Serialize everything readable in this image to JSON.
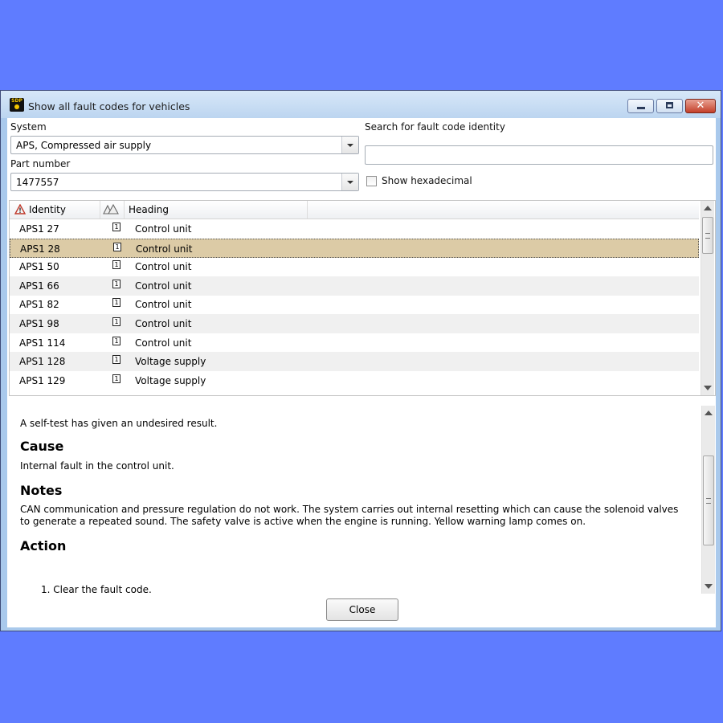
{
  "window": {
    "title": "Show all fault codes for vehicles",
    "app_icon_text": "SDP",
    "close_glyph": "✕"
  },
  "filters": {
    "system_label": "System",
    "system_value": "APS, Compressed air supply",
    "search_label": "Search for fault code identity",
    "search_value": "",
    "part_label": "Part number",
    "part_value": "1477557",
    "hex_label": "Show hexadecimal",
    "hex_checked": false
  },
  "list": {
    "columns": [
      "Identity",
      "Heading"
    ],
    "rows": [
      {
        "identity": "APS1 27",
        "icon": "1",
        "heading": "Control unit"
      },
      {
        "identity": "APS1 28",
        "icon": "1",
        "heading": "Control unit"
      },
      {
        "identity": "APS1 50",
        "icon": "1",
        "heading": "Control unit"
      },
      {
        "identity": "APS1 66",
        "icon": "1",
        "heading": "Control unit"
      },
      {
        "identity": "APS1 82",
        "icon": "1",
        "heading": "Control unit"
      },
      {
        "identity": "APS1 98",
        "icon": "1",
        "heading": "Control unit"
      },
      {
        "identity": "APS1 114",
        "icon": "1",
        "heading": "Control unit"
      },
      {
        "identity": "APS1 128",
        "icon": "1",
        "heading": "Voltage supply"
      },
      {
        "identity": "APS1 129",
        "icon": "1",
        "heading": "Voltage supply"
      }
    ],
    "selected_index": 1
  },
  "details": {
    "intro": "A self-test has given an undesired result.",
    "cause_heading": "Cause",
    "cause_text": "Internal fault in the control unit.",
    "notes_heading": "Notes",
    "notes_text": "CAN communication and pressure regulation do not work. The system carries out internal resetting which can cause the solenoid valves to generate a repeated sound. The safety valve is active when the engine is running. Yellow warning lamp comes on.",
    "action_heading": "Action",
    "action_step": "1.  Clear the fault code."
  },
  "buttons": {
    "close_label": "Close"
  }
}
